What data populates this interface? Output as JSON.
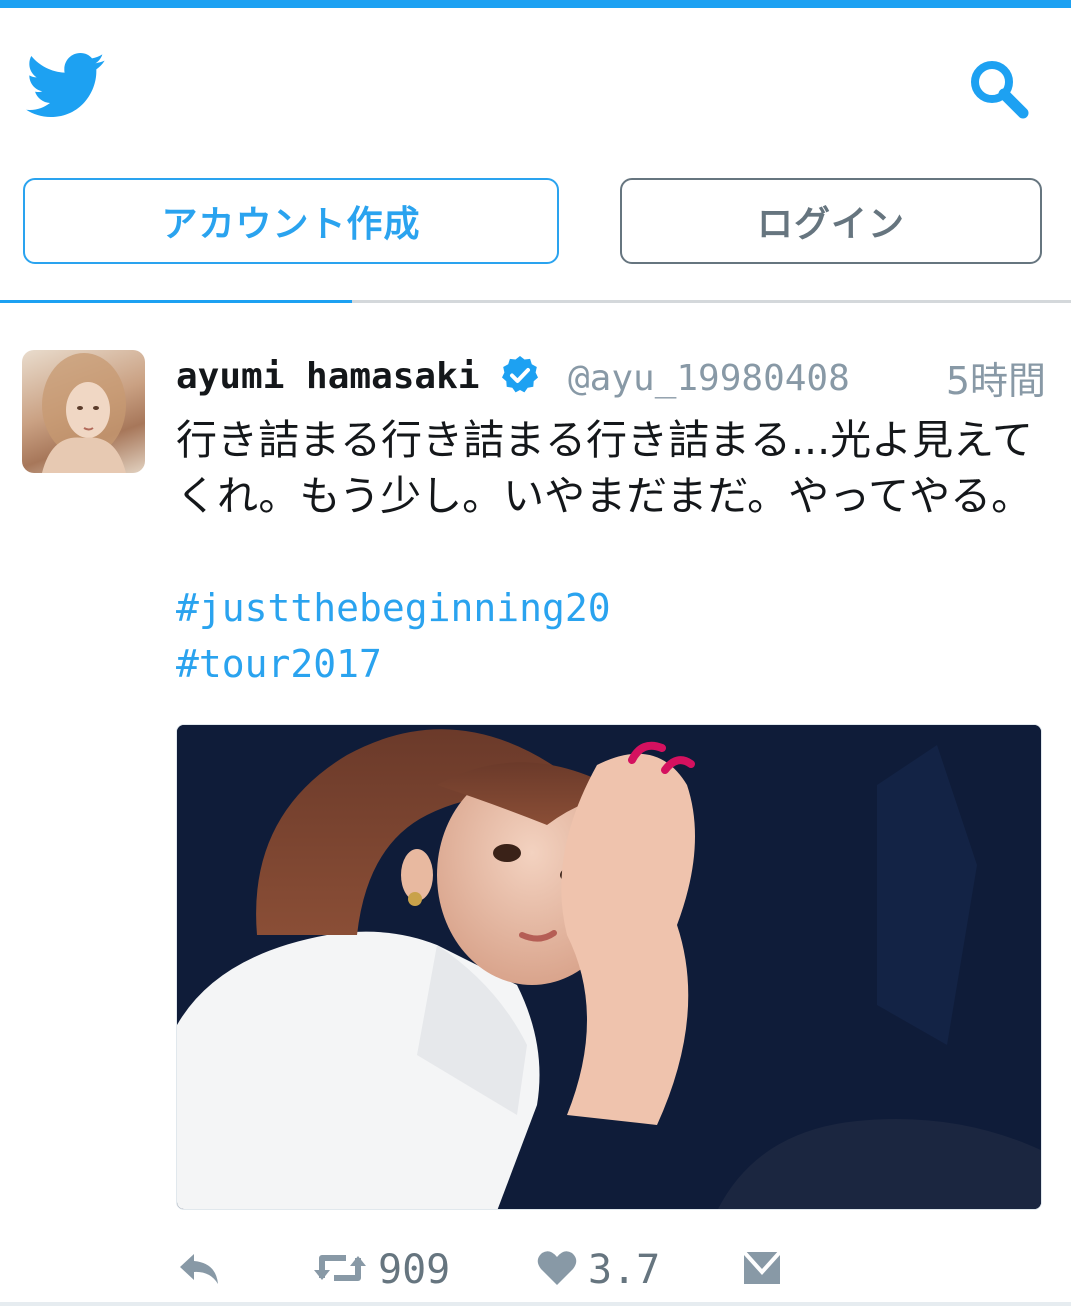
{
  "header": {
    "logo_icon": "twitter-bird-icon",
    "search_icon": "search-icon",
    "signup_label": "アカウント作成",
    "login_label": "ログイン"
  },
  "tweet": {
    "author_name": "ayumi hamasaki",
    "verified_icon": "verified-badge-icon",
    "handle": "@ayu_19980408",
    "time": "5時間",
    "text": "行き詰まる行き詰まる行き詰まる...光よ見えてくれ。もう少し。いやまだまだ。やってやる。",
    "hashtags": [
      "#justthebeginning20",
      "#tour2017"
    ],
    "actions": {
      "reply_icon": "reply-icon",
      "retweet_icon": "retweet-icon",
      "retweet_count": "909",
      "like_icon": "heart-icon",
      "like_count": "3.7",
      "dm_icon": "envelope-icon"
    }
  },
  "colors": {
    "brand": "#1da1f2",
    "text": "#14171a",
    "muted": "#8899a6"
  }
}
